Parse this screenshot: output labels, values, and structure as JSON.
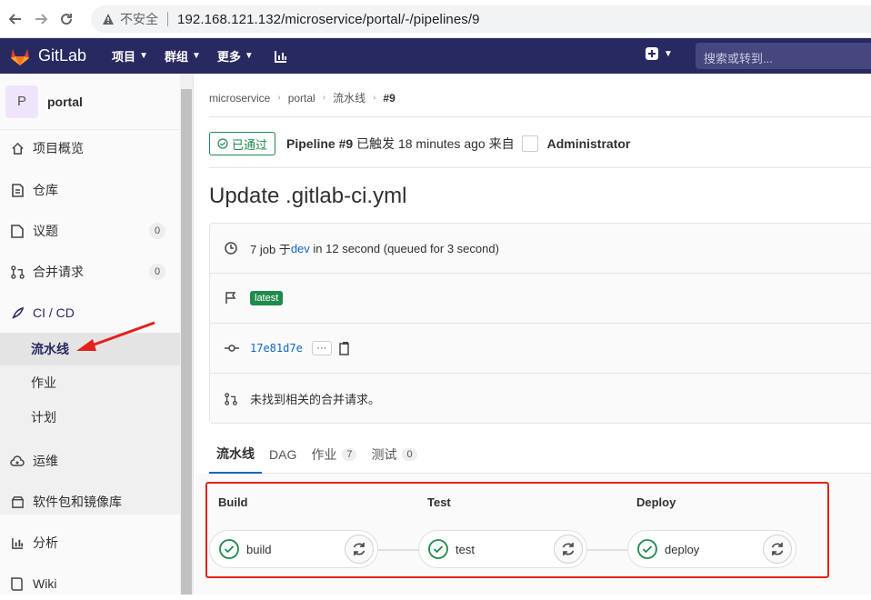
{
  "browser": {
    "insecure_label": "不安全",
    "url": "192.168.121.132/microservice/portal/-/pipelines/9"
  },
  "header": {
    "brand": "GitLab",
    "menus": [
      "项目",
      "群组",
      "更多"
    ],
    "search_placeholder": "搜索或转到..."
  },
  "sidebar": {
    "project_initial": "P",
    "project_name": "portal",
    "items": [
      {
        "label": "项目概览"
      },
      {
        "label": "仓库"
      },
      {
        "label": "议题",
        "badge": "0"
      },
      {
        "label": "合并请求",
        "badge": "0"
      },
      {
        "label": "CI / CD"
      },
      {
        "label": "运维"
      },
      {
        "label": "软件包和镜像库"
      },
      {
        "label": "分析"
      },
      {
        "label": "Wiki"
      }
    ],
    "cicd_sub": [
      "流水线",
      "作业",
      "计划"
    ]
  },
  "breadcrumb": [
    "microservice",
    "portal",
    "流水线",
    "#9"
  ],
  "status": {
    "badge": "已通过",
    "pipeline_label": "Pipeline #9",
    "triggered": "已触发",
    "time": "18 minutes ago",
    "from": "来自",
    "user": "Administrator"
  },
  "title": "Update .gitlab-ci.yml",
  "info": {
    "jobs_prefix": "7 job 于",
    "branch": "dev",
    "jobs_suffix": "in 12 second (queued for 3 second)",
    "tag": "latest",
    "sha": "17e81d7e",
    "ellipsis": "···",
    "mr_text": "未找到相关的合并请求。"
  },
  "tabs": [
    {
      "label": "流水线",
      "count": ""
    },
    {
      "label": "DAG",
      "count": ""
    },
    {
      "label": "作业",
      "count": "7"
    },
    {
      "label": "测试",
      "count": "0"
    }
  ],
  "stages": [
    {
      "name": "Build",
      "job": "build"
    },
    {
      "name": "Test",
      "job": "test"
    },
    {
      "name": "Deploy",
      "job": "deploy"
    }
  ],
  "colors": {
    "header_bg": "#292961",
    "success": "#1f8a4c",
    "link": "#1068bf",
    "annotation_red": "#e0231c"
  }
}
